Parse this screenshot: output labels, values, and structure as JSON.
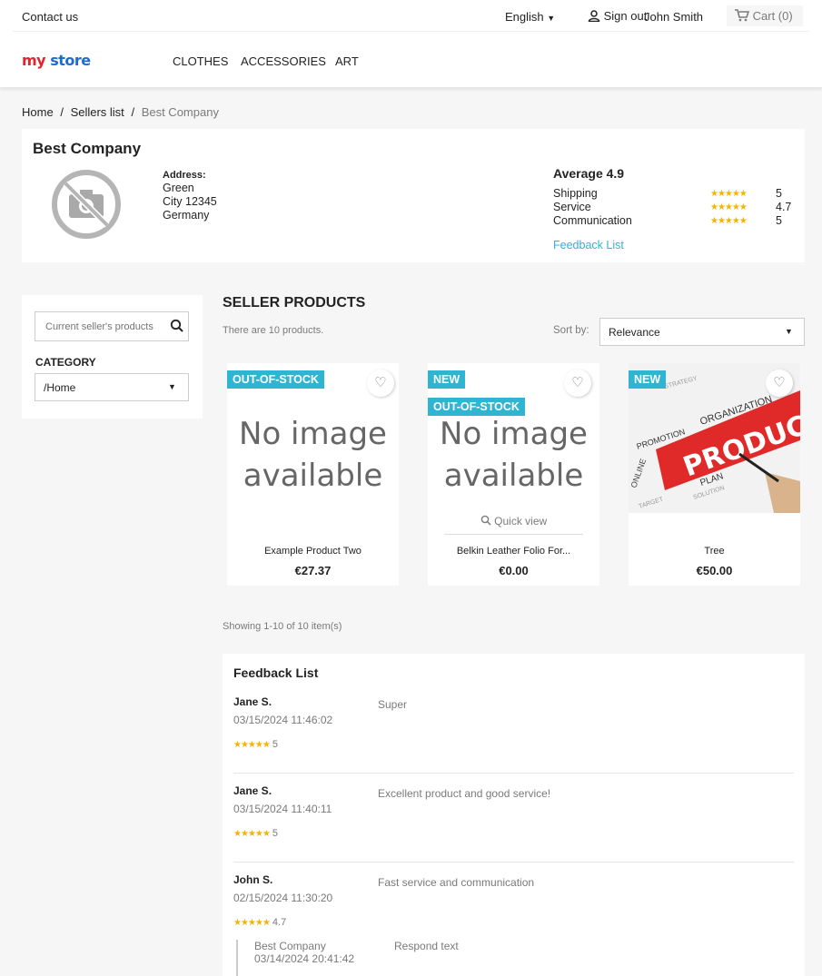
{
  "header": {
    "contact": "Contact us",
    "language": "English",
    "signout": "Sign out",
    "username": "John Smith",
    "cart": "Cart (0)",
    "logo_my": "my",
    "logo_store": "store",
    "menu": [
      "CLOTHES",
      "ACCESSORIES",
      "ART"
    ]
  },
  "breadcrumb": {
    "home": "Home",
    "sep1": "/",
    "sellers": "Sellers list",
    "sep2": "/",
    "current": "Best Company"
  },
  "seller": {
    "name": "Best Company",
    "address_label": "Address:",
    "address_lines": [
      "Green",
      "City 12345",
      "Germany"
    ],
    "average_label": "Average 4.9",
    "ratings": [
      {
        "label": "Shipping",
        "value": "5"
      },
      {
        "label": "Service",
        "value": "4.7"
      },
      {
        "label": "Communication",
        "value": "5"
      }
    ],
    "feedback_link": "Feedback List"
  },
  "sidebar": {
    "search_placeholder": "Current seller's products",
    "category_label": "CATEGORY",
    "category_value": "/Home"
  },
  "products_section": {
    "title": "SELLER PRODUCTS",
    "count": "There are 10 products.",
    "sort_label": "Sort by:",
    "sort_value": "Relevance",
    "showing": "Showing 1-10 of 10 item(s)"
  },
  "products": [
    {
      "name": "Example Product Two",
      "price": "€27.37",
      "flags": [
        "OUT-OF-STOCK"
      ],
      "noimage": [
        "No image",
        "available"
      ]
    },
    {
      "name": "Belkin Leather Folio For...",
      "price": "€0.00",
      "flags": [
        "NEW",
        "OUT-OF-STOCK"
      ],
      "noimage": [
        "No image",
        "available"
      ],
      "quickview": "Quick view"
    },
    {
      "name": "Tree",
      "price": "€50.00",
      "flags": [
        "NEW"
      ],
      "image_words": [
        "PRODUCT",
        "ORGANIZATION",
        "PROMOTION",
        "PLAN",
        "SOLUTION",
        "ONLINE",
        "TARGET",
        "STRATEGY"
      ]
    }
  ],
  "feedback": {
    "title": "Feedback List",
    "items": [
      {
        "name": "Jane S.",
        "date": "03/15/2024 11:46:02",
        "rating": "5",
        "text": "Super"
      },
      {
        "name": "Jane S.",
        "date": "03/15/2024 11:40:11",
        "rating": "5",
        "text": "Excellent product and good service!"
      },
      {
        "name": "John S.",
        "date": "02/15/2024 11:30:20",
        "rating": "4.7",
        "text": "Fast service and communication",
        "response": {
          "company": "Best Company",
          "date": "03/14/2024 20:41:42",
          "text": "Respond text"
        }
      }
    ]
  },
  "colors": {
    "accent": "#2fb5d2",
    "star": "#f4b400",
    "logo_red": "#e3232d",
    "logo_blue": "#1f6bd0"
  }
}
